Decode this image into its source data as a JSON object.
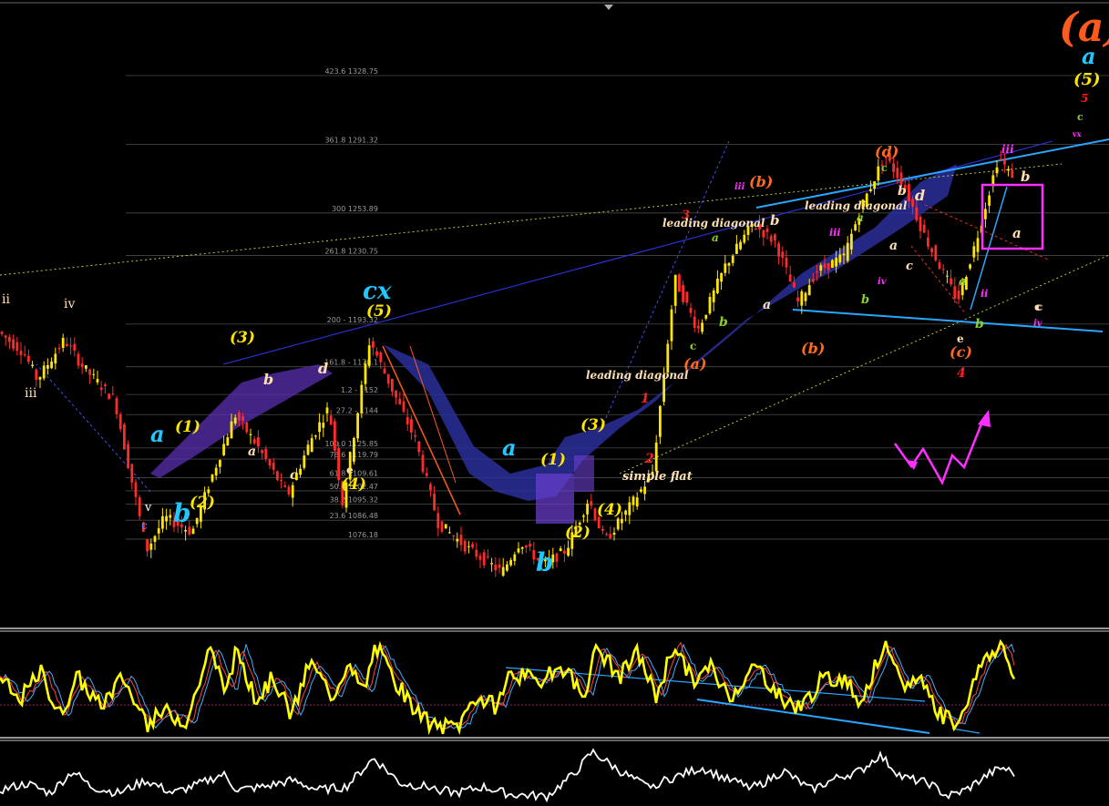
{
  "chart_data": {
    "type": "candlestick",
    "title": "",
    "xlabel": "",
    "ylabel": "",
    "price_range": [
      1030,
      1360
    ],
    "grid": false,
    "fib_levels": [
      {
        "label": "423.6 1328.75",
        "price": 1328.75
      },
      {
        "label": "361.8 1291.32",
        "price": 1291.32
      },
      {
        "label": "300 1253.89",
        "price": 1253.89
      },
      {
        "label": "261.8 1230.75",
        "price": 1230.75
      },
      {
        "label": "200 - 1193.32",
        "price": 1193.32
      },
      {
        "label": "161.8 - 1170.1",
        "price": 1170.1
      },
      {
        "label": "1.2 - 1152",
        "price": 1155
      },
      {
        "label": "27.2 - 1144",
        "price": 1144
      },
      {
        "label": "100.0 1125.85",
        "price": 1125.85
      },
      {
        "label": "78.6 1119.79",
        "price": 1119.79
      },
      {
        "label": "61.8 1109.61",
        "price": 1109.61
      },
      {
        "label": "50.0 1102.47",
        "price": 1102.47
      },
      {
        "label": "38.2 1095.32",
        "price": 1095.32
      },
      {
        "label": "23.6 1086.48",
        "price": 1086.48
      },
      {
        "label": "1076.18",
        "price": 1076.18
      }
    ],
    "wave_labels": [
      {
        "text": "(a)",
        "color": "#ff5a1e"
      },
      {
        "text": "a",
        "color": "#20c8ff"
      },
      {
        "text": "(5)",
        "color": "#ffe600"
      },
      {
        "text": "5",
        "color": "#ff2020"
      },
      {
        "text": "c",
        "color": "#8ccf2a"
      },
      {
        "text": "vx",
        "color": "#ff30ff"
      },
      {
        "text": "ii",
        "color": "#ffe0b0"
      },
      {
        "text": "iv",
        "color": "#ffe0b0"
      },
      {
        "text": "iii",
        "color": "#ffe0b0"
      },
      {
        "text": "v",
        "color": "#ffffff"
      },
      {
        "text": "c",
        "color": "#4488ff"
      },
      {
        "text": "a",
        "color": "#20c8ff"
      },
      {
        "text": "b",
        "color": "#20c8ff"
      },
      {
        "text": "(1)",
        "color": "#ffe600"
      },
      {
        "text": "(2)",
        "color": "#ffe600"
      },
      {
        "text": "(3)",
        "color": "#ffe600"
      },
      {
        "text": "(4)",
        "color": "#ffe600"
      },
      {
        "text": "(5)",
        "color": "#ffe600"
      },
      {
        "text": "a",
        "color": "#ffe0b0"
      },
      {
        "text": "b",
        "color": "#ffe0b0"
      },
      {
        "text": "c",
        "color": "#ffe0b0"
      },
      {
        "text": "d",
        "color": "#ffe0b0"
      },
      {
        "text": "e",
        "color": "#ffe0b0"
      },
      {
        "text": "cx",
        "color": "#20c8ff"
      },
      {
        "text": "a",
        "color": "#20c8ff"
      },
      {
        "text": "b",
        "color": "#20c8ff"
      },
      {
        "text": "(1)",
        "color": "#ffe600"
      },
      {
        "text": "(2)",
        "color": "#ffe600"
      },
      {
        "text": "(3)",
        "color": "#ffe600"
      },
      {
        "text": "(4)",
        "color": "#ffe600"
      },
      {
        "text": "leading diagonal",
        "color": "#ffe0b0"
      },
      {
        "text": "simple flat",
        "color": "#ffe0b0"
      },
      {
        "text": "1",
        "color": "#ff2020"
      },
      {
        "text": "2",
        "color": "#ff2020"
      },
      {
        "text": "3",
        "color": "#ff2020"
      },
      {
        "text": "(a)",
        "color": "#ff6a1e"
      },
      {
        "text": "(b)",
        "color": "#ff6a1e"
      },
      {
        "text": "(b)",
        "color": "#ff6a1e"
      },
      {
        "text": "(c)",
        "color": "#ff6a1e"
      },
      {
        "text": "(d)",
        "color": "#ff6a1e"
      },
      {
        "text": "4",
        "color": "#ff2020"
      },
      {
        "text": "leading diagonal",
        "color": "#ffe0b0"
      },
      {
        "text": "leading diagonal",
        "color": "#ffe0b0"
      },
      {
        "text": "a",
        "color": "#ffe0b0"
      },
      {
        "text": "b",
        "color": "#ffe0b0"
      },
      {
        "text": "c",
        "color": "#ffe0b0"
      },
      {
        "text": "d",
        "color": "#ffe0b0"
      },
      {
        "text": "e",
        "color": "#ffe0b0"
      },
      {
        "text": "a",
        "color": "#ffe0b0"
      },
      {
        "text": "b",
        "color": "#ffe0b0"
      },
      {
        "text": "c",
        "color": "#ffe0b0"
      },
      {
        "text": "a",
        "color": "#8ccf2a"
      },
      {
        "text": "b",
        "color": "#8ccf2a"
      },
      {
        "text": "c",
        "color": "#8ccf2a"
      },
      {
        "text": "a",
        "color": "#8ccf2a"
      },
      {
        "text": "b",
        "color": "#8ccf2a"
      },
      {
        "text": "c",
        "color": "#8ccf2a"
      },
      {
        "text": "b",
        "color": "#8ccf2a"
      },
      {
        "text": "a",
        "color": "#8ccf2a"
      },
      {
        "text": "iii",
        "color": "#ff30ff"
      },
      {
        "text": "iii",
        "color": "#ff30ff"
      },
      {
        "text": "iv",
        "color": "#ff30ff"
      },
      {
        "text": "ii",
        "color": "#ff30ff"
      },
      {
        "text": "iii",
        "color": "#ff30ff"
      },
      {
        "text": "b",
        "color": "#ffe0b0"
      },
      {
        "text": "a",
        "color": "#ffe0b0"
      },
      {
        "text": "c",
        "color": "#ffe0b0"
      },
      {
        "text": "iv",
        "color": "#ff30ff"
      }
    ],
    "oscillator_scale": [
      0,
      100
    ],
    "indicator_scale": [
      0,
      100
    ],
    "colors": {
      "background": "#000000",
      "bull_candle": "#ffe600",
      "bear_candle": "#ff2a2a",
      "channel": "#3a3fc8",
      "trendline": "#2aa6ff",
      "oscillator": "#ffff00",
      "signal": "#ff4444",
      "signal2": "#40b0ff",
      "indicator": "#ffffff",
      "annotation": "#ff30ff"
    }
  }
}
